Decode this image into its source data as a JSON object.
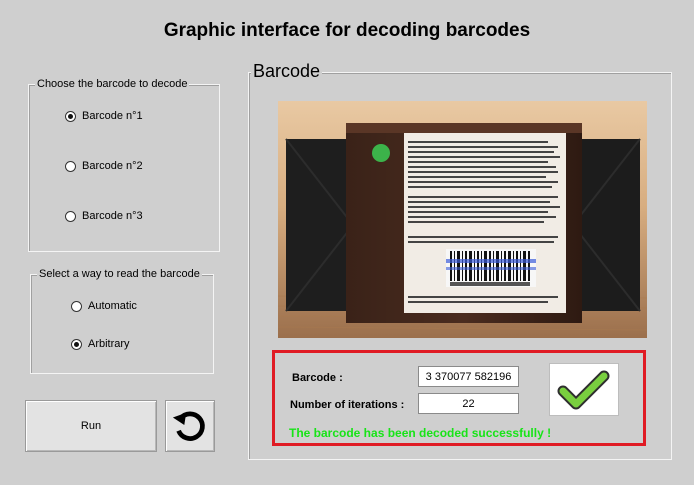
{
  "window": {
    "title": "Graphic interface for decoding barcodes"
  },
  "choose_panel": {
    "legend": "Choose the barcode to decode",
    "options": [
      {
        "label": "Barcode n°1",
        "checked": true
      },
      {
        "label": "Barcode n°2",
        "checked": false
      },
      {
        "label": "Barcode n°3",
        "checked": false
      }
    ]
  },
  "read_panel": {
    "legend": "Select a way to read the barcode",
    "options": [
      {
        "label": "Automatic",
        "checked": false
      },
      {
        "label": "Arbitrary",
        "checked": true
      }
    ]
  },
  "buttons": {
    "run_label": "Run",
    "reset_icon": "refresh-icon"
  },
  "barcode_panel": {
    "legend": "Barcode",
    "image_icon": "package-photo",
    "result": {
      "barcode_label": "Barcode :",
      "barcode_value": "3 370077 582196",
      "iterations_label": "Number of iterations :",
      "iterations_value": "22",
      "message": "The barcode has been decoded successfully !",
      "status_icon": "checkmark-icon"
    }
  },
  "colors": {
    "success": "#18e418",
    "highlight_border": "#e01b24",
    "checkmark": "#79cf3f"
  }
}
